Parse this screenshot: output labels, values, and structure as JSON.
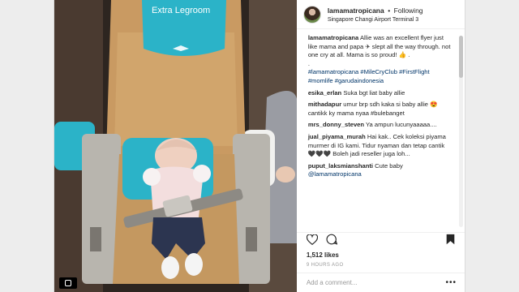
{
  "post": {
    "username": "lamamatropicana",
    "dot": "•",
    "follow_status": "Following",
    "location": "Singapore Changi Airport Terminal 3",
    "seat_label": "Extra Legroom",
    "caption": {
      "text": "Allie was an excellent flyer just like mama and papa ✈ slept all the way through. not one cry at all. Mama is so proud! 👍 .",
      "dot": ".",
      "hashtags": "#lamamatropicana #MileCryClub #FirstFlight #momlife #garudaindonesia"
    },
    "comments": [
      {
        "user": "esika_erlan",
        "text": "Suka bgt liat baby allie"
      },
      {
        "user": "mithadapur",
        "text": "umur brp sdh kaka si baby allie 😍cantikk ky mama nyaa #bulebanget"
      },
      {
        "user": "mrs_donny_steven",
        "text": "Ya ampun lucunyaaaaa...."
      },
      {
        "user": "jual_piyama_murah",
        "text": "Hai kak.. Cek koleksi piyama murmer di IG kami. Tidur nyaman dan tetap cantik 🖤🖤🖤 Boleh jadi reseller juga loh..."
      },
      {
        "user": "puput_laksmianshanti",
        "text": "Cute baby",
        "mention": "@lamamatropicana"
      }
    ],
    "likes": "1,512 likes",
    "time": "9 HOURS AGO",
    "comment_placeholder": "Add a comment...",
    "more_label": "•••"
  },
  "icons": {
    "like": "heart-icon",
    "comment": "speech-bubble-icon",
    "save": "bookmark-icon",
    "instagram": "instagram-icon"
  },
  "colors": {
    "text": "#262626",
    "link": "#003569",
    "muted": "#999999",
    "seat_accent": "#2bb3c8"
  }
}
